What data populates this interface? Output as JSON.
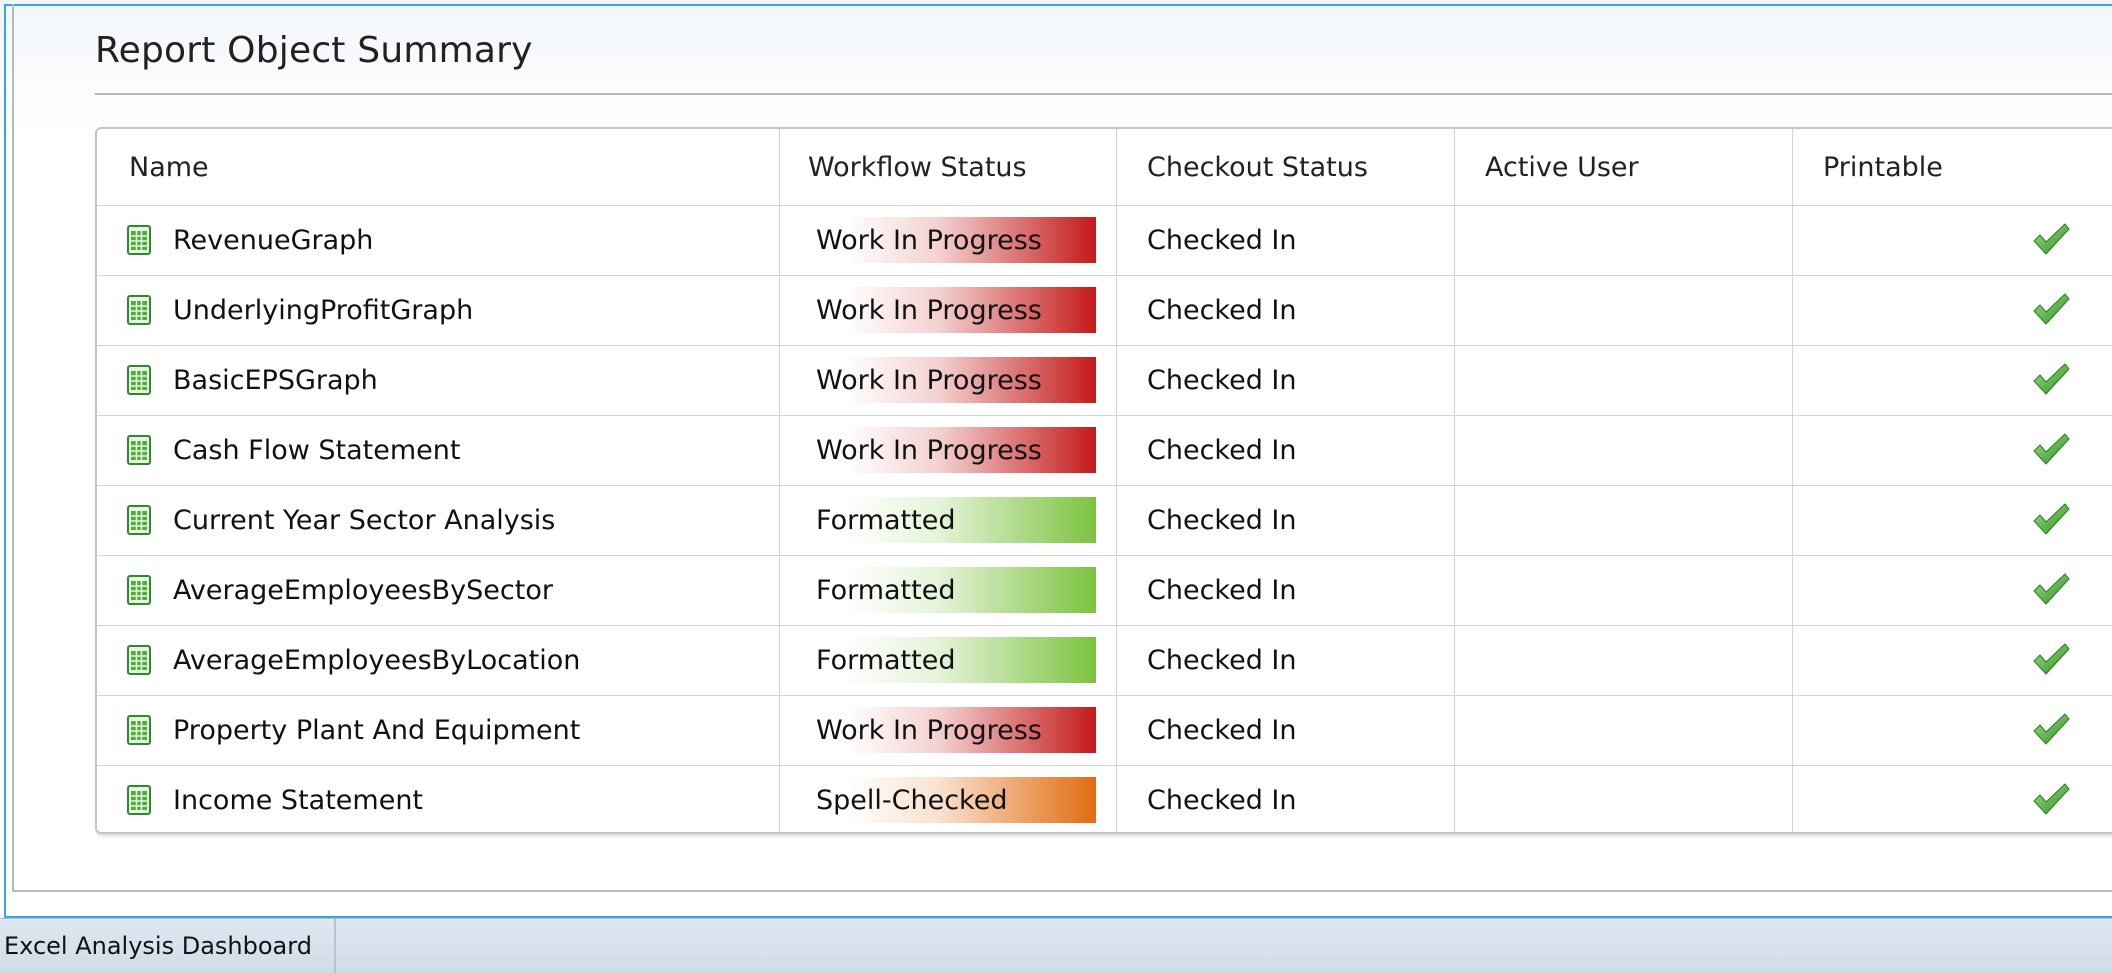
{
  "title": "Report Object Summary",
  "table": {
    "headers": [
      "Name",
      "Workflow Status",
      "Checkout Status",
      "Active User",
      "Printable"
    ],
    "rows": [
      {
        "name": "RevenueGraph",
        "workflow": "Work In Progress",
        "workflow_kind": "wip",
        "checkout": "Checked In",
        "active_user": "",
        "printable": true
      },
      {
        "name": "UnderlyingProfitGraph",
        "workflow": "Work In Progress",
        "workflow_kind": "wip",
        "checkout": "Checked In",
        "active_user": "",
        "printable": true
      },
      {
        "name": "BasicEPSGraph",
        "workflow": "Work In Progress",
        "workflow_kind": "wip",
        "checkout": "Checked In",
        "active_user": "",
        "printable": true
      },
      {
        "name": "Cash Flow Statement",
        "workflow": "Work In Progress",
        "workflow_kind": "wip",
        "checkout": "Checked In",
        "active_user": "",
        "printable": true
      },
      {
        "name": "Current Year Sector Analysis",
        "workflow": "Formatted",
        "workflow_kind": "formatted",
        "checkout": "Checked In",
        "active_user": "",
        "printable": true
      },
      {
        "name": "AverageEmployeesBySector",
        "workflow": "Formatted",
        "workflow_kind": "formatted",
        "checkout": "Checked In",
        "active_user": "",
        "printable": true
      },
      {
        "name": "AverageEmployeesByLocation",
        "workflow": "Formatted",
        "workflow_kind": "formatted",
        "checkout": "Checked In",
        "active_user": "",
        "printable": true
      },
      {
        "name": "Property Plant And Equipment",
        "workflow": "Work In Progress",
        "workflow_kind": "wip",
        "checkout": "Checked In",
        "active_user": "",
        "printable": true
      },
      {
        "name": "Income Statement",
        "workflow": "Spell-Checked",
        "workflow_kind": "spellchecked",
        "checkout": "Checked In",
        "active_user": "",
        "printable": true
      }
    ]
  },
  "status_colors": {
    "wip": "#c41a1a",
    "formatted": "#7cc340",
    "spellchecked": "#e16b11"
  },
  "icons": {
    "row_icon": "spreadsheet-icon",
    "printable_icon": "checkmark-icon"
  },
  "statusbar": {
    "tab_label": "Excel Analysis Dashboard"
  }
}
